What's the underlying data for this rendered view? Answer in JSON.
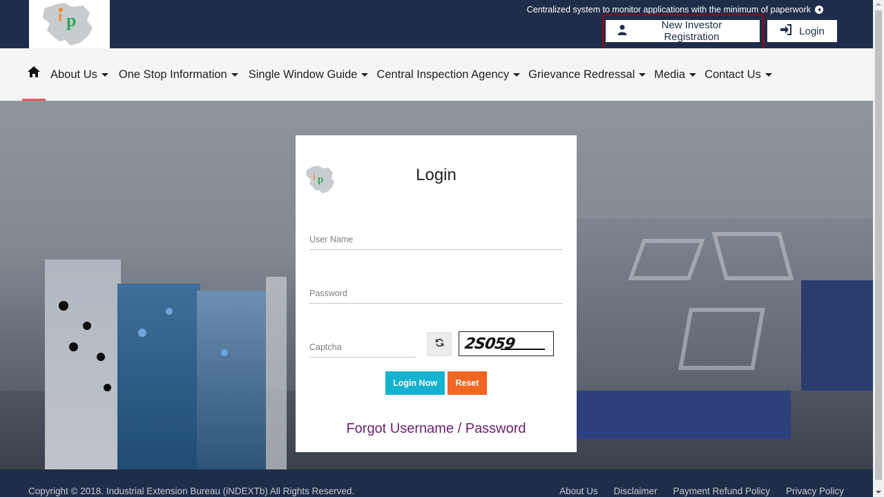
{
  "header": {
    "logo_alt": "iP",
    "tagline": "Centralized system to monitor applications with the minimum of paperwork",
    "register_label": "New Investor Registration",
    "login_label": "Login"
  },
  "nav": {
    "items": [
      {
        "label": "About Us"
      },
      {
        "label": "One Stop Information"
      },
      {
        "label": "Single Window Guide"
      },
      {
        "label": "Central Inspection Agency"
      },
      {
        "label": "Grievance Redressal"
      },
      {
        "label": "Media"
      },
      {
        "label": "Contact Us"
      }
    ]
  },
  "login_card": {
    "title": "Login",
    "username_placeholder": "User Name",
    "password_placeholder": "Password",
    "captcha_placeholder": "Captcha",
    "captcha_code": "2S059",
    "login_button": "Login Now",
    "reset_button": "Reset",
    "forgot_link": "Forgot Username / Password"
  },
  "footer": {
    "copyright": "Copyright © 2018. Industrial Extension Bureau (iNDEXTb) All Rights Reserved.",
    "links": [
      "About Us",
      "Disclaimer",
      "Payment Refund Policy",
      "Privacy Policy"
    ]
  },
  "colors": {
    "header_bg": "#1f2d4a",
    "highlight": "#7a0f22",
    "login_button": "#13b3cf",
    "reset_button": "#f26522",
    "forgot_link": "#6d1e72",
    "active_underline": "#e85858"
  }
}
